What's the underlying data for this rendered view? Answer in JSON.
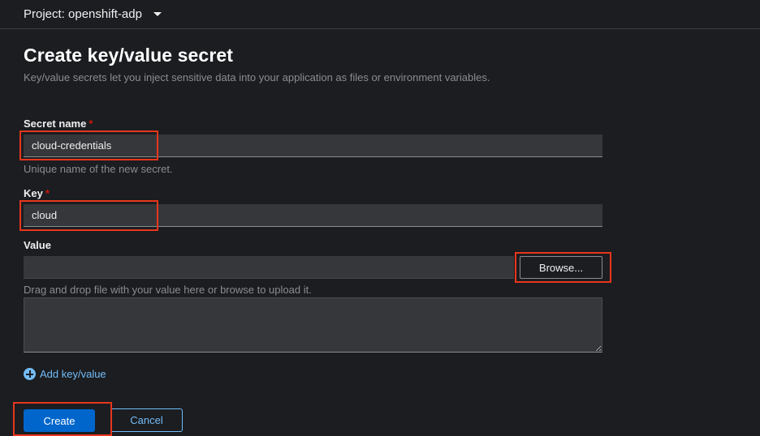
{
  "header": {
    "project_label": "Project: openshift-adp",
    "dropdown_icon": "caret-down-icon"
  },
  "form": {
    "title": "Create key/value secret",
    "description": "Key/value secrets let you inject sensitive data into your application as files or environment variables.",
    "required_marker": "*",
    "secret_name": {
      "label": "Secret name",
      "value": "cloud-credentials",
      "helper": "Unique name of the new secret."
    },
    "key": {
      "label": "Key",
      "value": "cloud"
    },
    "value": {
      "label": "Value",
      "file_value": "",
      "browse_label": "Browse...",
      "helper": "Drag and drop file with your value here or browse to upload it.",
      "text": ""
    },
    "add_pair_label": "Add key/value",
    "add_pair_icon": "plus-circle-icon",
    "create_label": "Create",
    "cancel_label": "Cancel"
  },
  "colors": {
    "background": "#1b1d21",
    "primary": "#0066cc",
    "link": "#73bcf7",
    "required": "#c9190b",
    "annotation_box": "#e8361b"
  }
}
